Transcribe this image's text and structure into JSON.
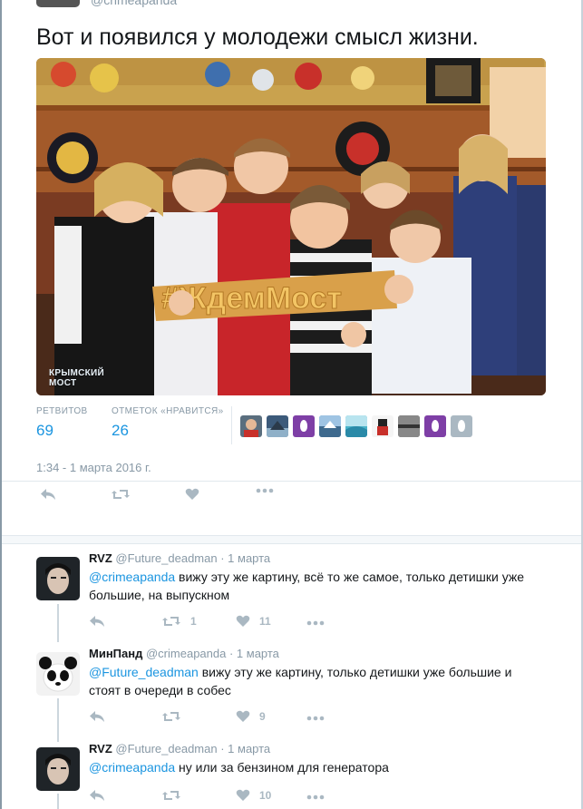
{
  "tweet": {
    "top_handle": "@crimeapanda",
    "text": "Вот и появился у молодежи смысл жизни.",
    "photo_logo_line1": "КРЫМСКИЙ",
    "photo_logo_line2": "МОСТ",
    "sign_text": "#ЖдемМост",
    "stats": {
      "retweets_label": "РЕТВИТОВ",
      "retweets_value": "69",
      "likes_label": "ОТМЕТОК «НРАВИТСЯ»",
      "likes_value": "26"
    },
    "timestamp": "1:34 - 1 марта 2016 г."
  },
  "replies": [
    {
      "name": "RVZ",
      "handle": "@Future_deadman",
      "date": "· 1 марта",
      "mention": "@crimeapanda",
      "text": " вижу эту же картину, всё то же самое, только детишки уже большие, на выпускном",
      "retweets": "1",
      "likes": "11"
    },
    {
      "name": "МинПанд",
      "handle": "@crimeapanda",
      "date": "· 1 марта",
      "mention": "@Future_deadman",
      "text": " вижу эту же картину, только детишки уже большие и стоят в очереди в собес",
      "retweets": "",
      "likes": "9"
    },
    {
      "name": "RVZ",
      "handle": "@Future_deadman",
      "date": "· 1 марта",
      "mention": "@crimeapanda",
      "text": " ну или за бензином для генератора",
      "retweets": "",
      "likes": "10"
    }
  ],
  "colors": {
    "accent": "#1b95e0",
    "muted": "#8899a6",
    "icon": "#aab8c2"
  },
  "icons": [
    "reply-icon",
    "retweet-icon",
    "heart-icon",
    "more-icon"
  ]
}
